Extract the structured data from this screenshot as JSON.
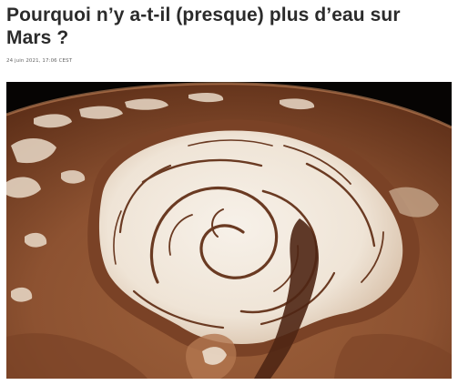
{
  "article": {
    "title": "Pourquoi n’y a-t-il (presque) plus d’eau sur Mars ?",
    "date": "24 juin 2021, 17:06 CEST"
  },
  "image": {
    "subject": "mars-north-polar-ice-cap",
    "colors": {
      "space": "#050403",
      "surface": "#a0663f",
      "surface_dark": "#5a2f1a",
      "ice": "#f3ece3"
    }
  }
}
